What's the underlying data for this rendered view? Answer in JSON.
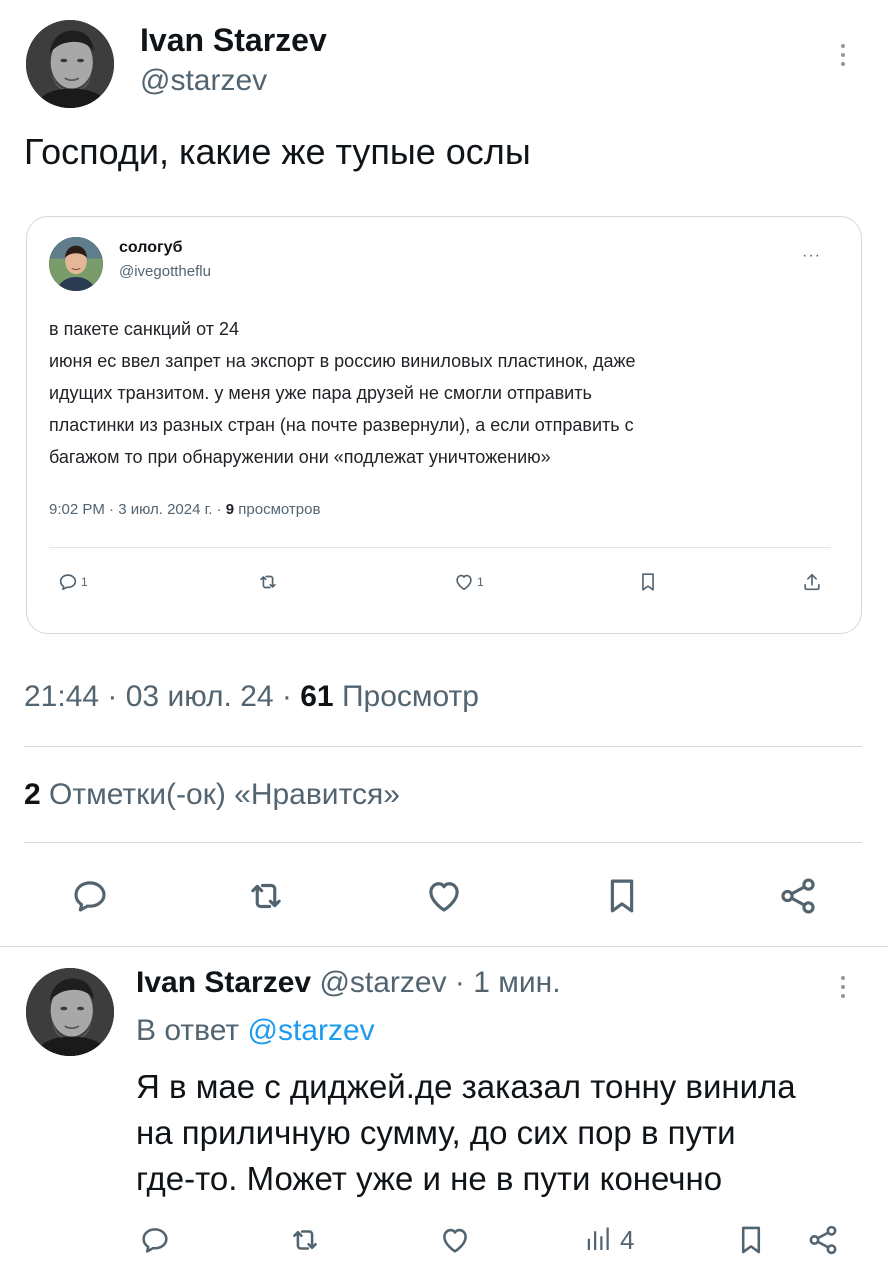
{
  "tweet": {
    "author_name": "Ivan Starzev",
    "author_handle": "@starzev",
    "text": "Господи, какие же тупые ослы",
    "timestamp": "21:44 · 03 июл. 24 · ",
    "views_count": "61",
    "views_label": " Просмотр",
    "likes_count": "2",
    "likes_label": " Отметки(-ок) «Нравится»"
  },
  "quoted_tweet": {
    "author_name": "сологуб",
    "author_handle": "@ivegottheflu",
    "more": "···",
    "lines": [
      "в пакете санкций от 24",
      "июня ес ввел запрет на экспорт в россию виниловых пластинок, даже",
      "идущих транзитом. у меня уже пара друзей не смогли отправить",
      "пластинки из разных стран (на почте развернули), а если отправить с",
      "багажом то при обнаружении они «подлежат уничтожению»"
    ],
    "meta": "9:02 PM · 3 июл. 2024 г. · ",
    "views": "9",
    "views_label": " просмотров",
    "reply_count": "1",
    "like_count": "1"
  },
  "reply": {
    "author_name": "Ivan Starzev",
    "author_handle": "@starzev",
    "time": " · 1 мин.",
    "reply_to_label": "В ответ ",
    "reply_to_handle": "@starzev",
    "lines": [
      "Я в мае с диджей.де заказал тонну винила",
      "на приличную сумму, до сих пор в пути",
      "где-то. Может уже и не в пути конечно"
    ],
    "views_count": "4"
  },
  "icons": {
    "reply": "reply-icon",
    "retweet": "retweet-icon",
    "like": "heart-icon",
    "bookmark": "bookmark-icon",
    "share": "share-icon",
    "views": "views-icon",
    "more": "more-vertical-icon"
  },
  "colors": {
    "text": "#0f1419",
    "secondary": "#536471",
    "link": "#1d9bf0",
    "border": "#cfd9de"
  }
}
